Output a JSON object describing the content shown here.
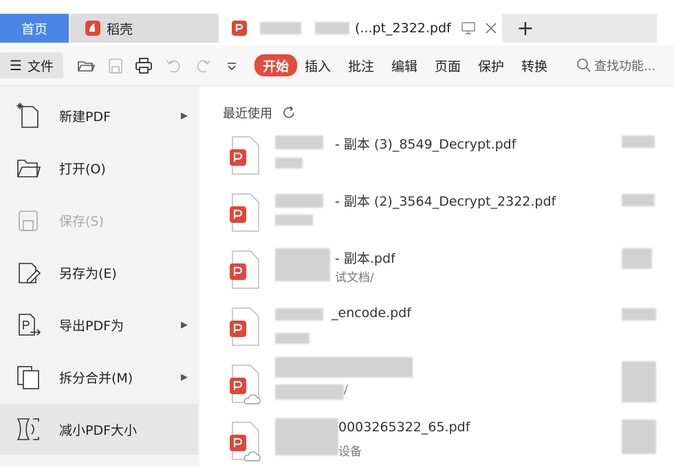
{
  "tabs": {
    "home": "首页",
    "docer": "稻壳",
    "pdf_title": "(...pt_2322.pdf",
    "add": "+"
  },
  "toolbar": {
    "file_label": "文件",
    "menu_tabs": [
      "开始",
      "插入",
      "批注",
      "编辑",
      "页面",
      "保护",
      "转换"
    ],
    "find_placeholder": "查找功能..."
  },
  "sidebar": {
    "items": [
      {
        "label": "新建PDF",
        "has_submenu": true,
        "icon": "new-file-icon"
      },
      {
        "label": "打开(O)",
        "has_submenu": false,
        "icon": "folder-open-icon"
      },
      {
        "label": "保存(S)",
        "has_submenu": false,
        "icon": "save-icon",
        "disabled": true
      },
      {
        "label": "另存为(E)",
        "has_submenu": false,
        "icon": "save-as-icon"
      },
      {
        "label": "导出PDF为",
        "has_submenu": true,
        "icon": "export-icon"
      },
      {
        "label": "拆分合并(M)",
        "has_submenu": true,
        "icon": "split-merge-icon"
      },
      {
        "label": "减小PDF大小",
        "has_submenu": false,
        "icon": "compress-icon",
        "selected": true
      }
    ]
  },
  "main": {
    "recent_label": "最近使用",
    "files": [
      {
        "name": "- 副本 (3)_8549_Decrypt.pdf",
        "path": ""
      },
      {
        "name": "- 副本 (2)_3564_Decrypt_2322.pdf",
        "path": ""
      },
      {
        "name": "- 副本.pdf",
        "path": "试文档/"
      },
      {
        "name": "_encode.pdf",
        "path": ""
      },
      {
        "name": "",
        "path": "/"
      },
      {
        "name": "0003265322_65.pdf",
        "path": "设备"
      }
    ]
  },
  "colors": {
    "accent_red": "#e24b3e",
    "home_blue": "#4a86e8",
    "pdf_red": "#e0463a"
  }
}
